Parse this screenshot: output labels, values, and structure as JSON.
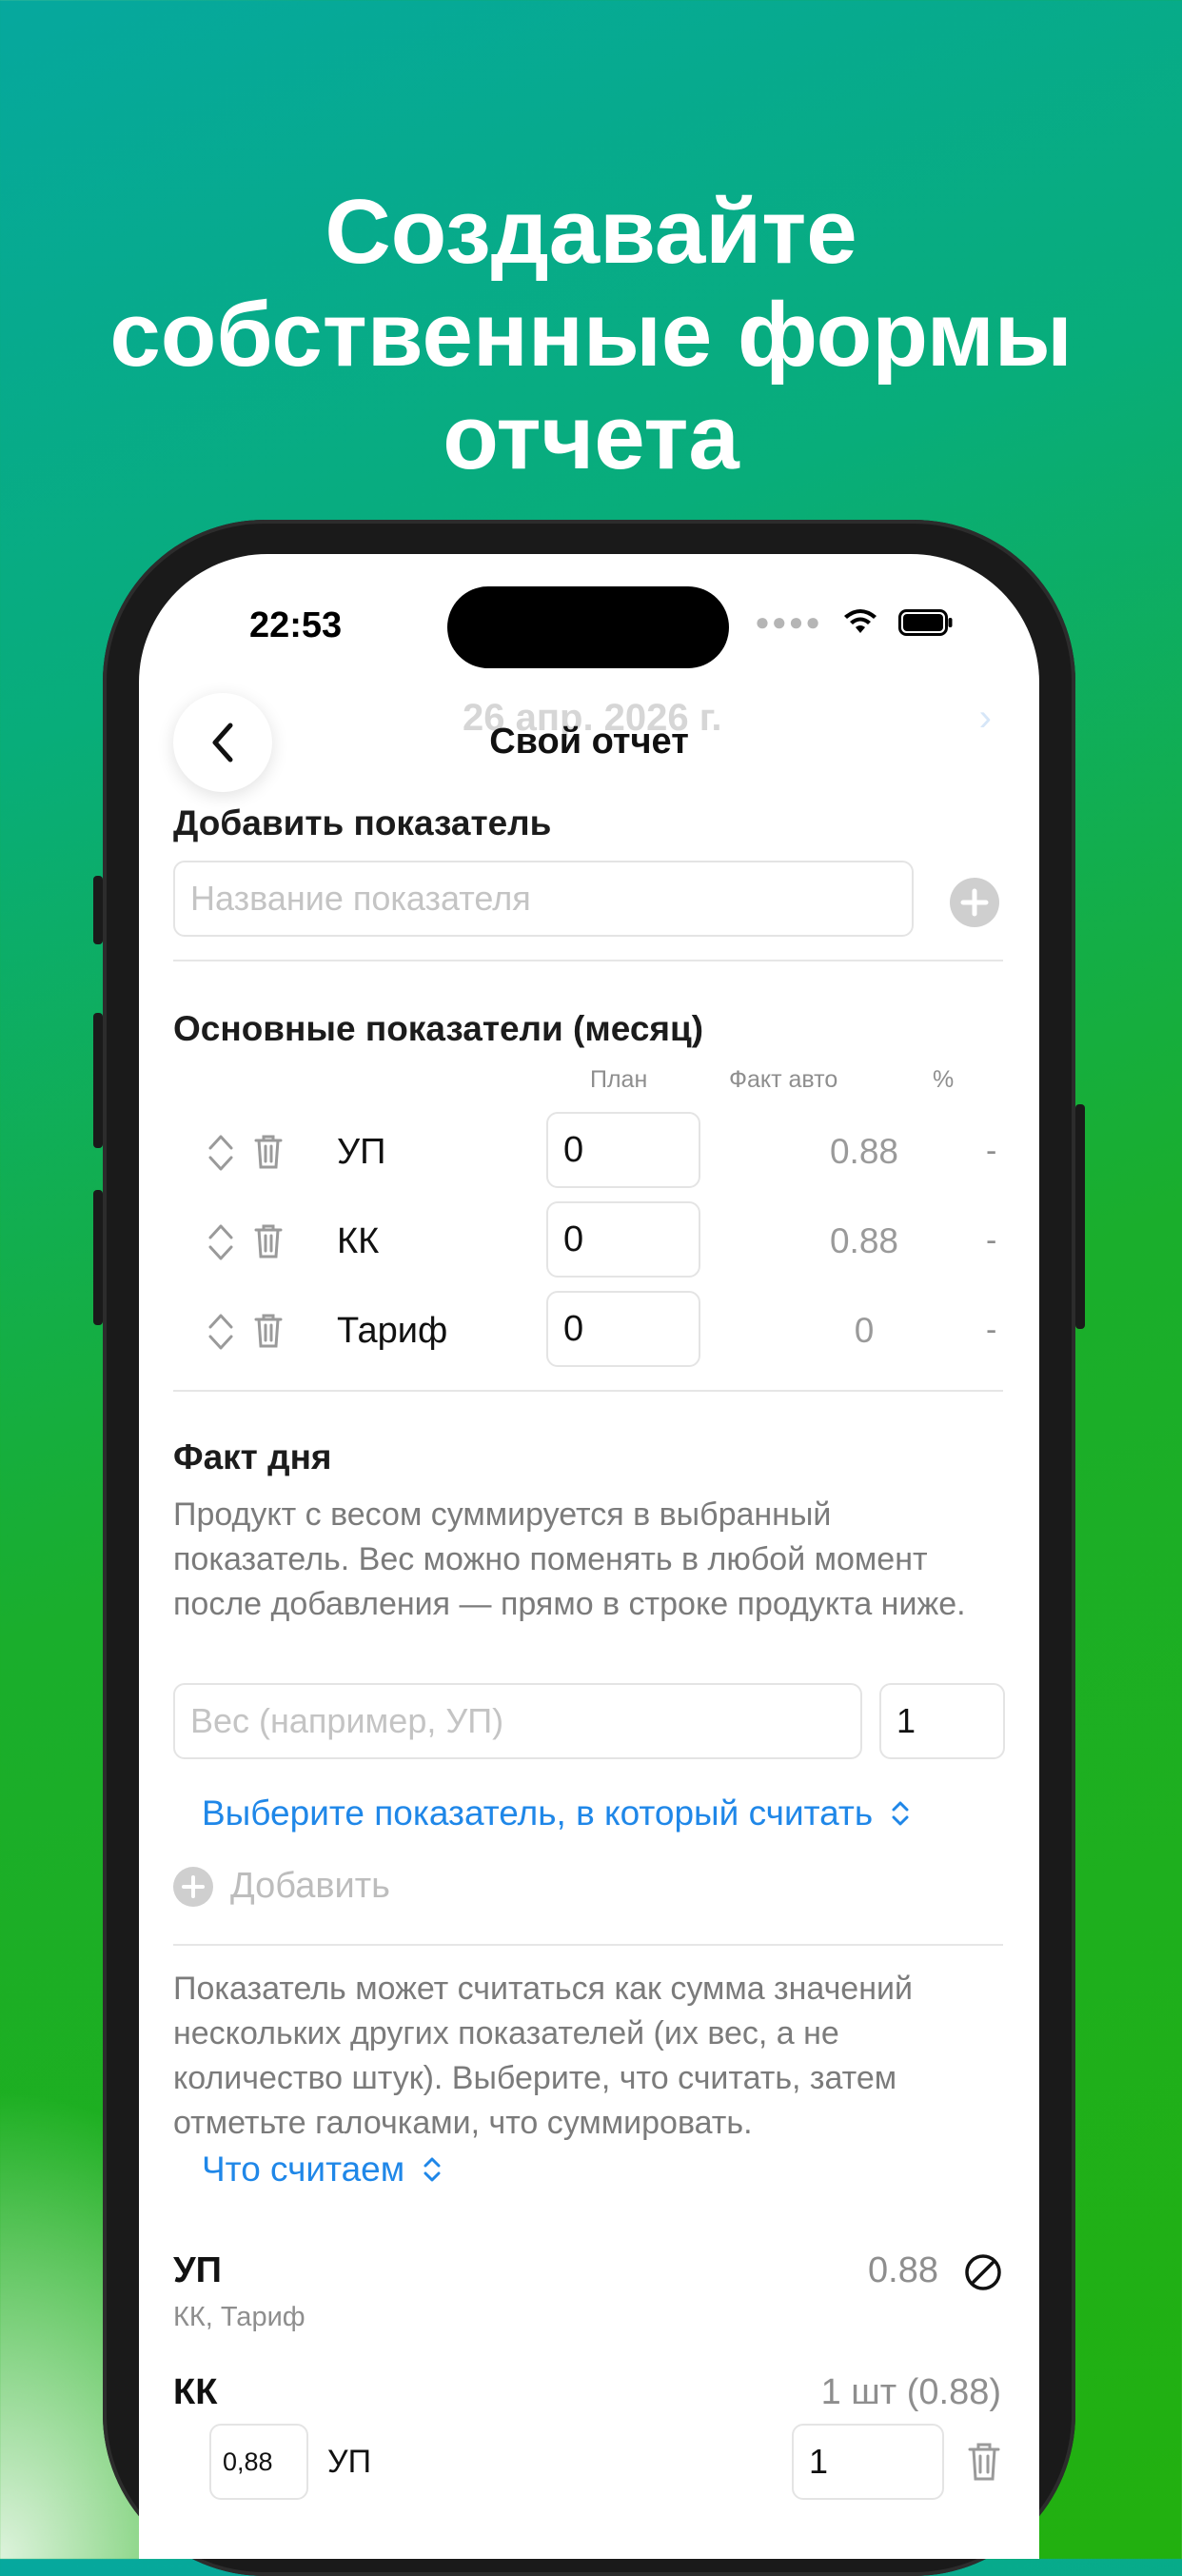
{
  "headline": [
    "Создавайте",
    "собственные формы",
    "отчета"
  ],
  "status": {
    "time": "22:53"
  },
  "nav": {
    "title": "Свой отчет",
    "ghost_date": "26 апр. 2026 г."
  },
  "add_metric": {
    "title": "Добавить показатель",
    "placeholder": "Название показателя"
  },
  "main_metrics": {
    "title": "Основные показатели (месяц)",
    "columns": {
      "plan": "План",
      "fact": "Факт авто",
      "pct": "%"
    },
    "rows": [
      {
        "name": "УП",
        "plan": "0",
        "fact": "0.88",
        "pct": "-"
      },
      {
        "name": "КК",
        "plan": "0",
        "fact": "0.88",
        "pct": "-"
      },
      {
        "name": "Тариф",
        "plan": "0",
        "fact": "0",
        "pct": "-"
      }
    ]
  },
  "day_fact": {
    "title": "Факт дня",
    "description": "Продукт с весом суммируется в выбранный показатель. Вес можно поменять в любой момент после добавления — прямо в строке продукта ниже.",
    "weight_placeholder": "Вес (например, УП)",
    "count_value": "1",
    "select_metric": "Выберите показатель, в который считать",
    "add_label": "Добавить",
    "sum_description": "Показатель может считаться как сумма значений нескольких других показателей (их вес, а не количество штук). Выберите, что считать, затем отметьте галочками, что суммировать.",
    "what_count": "Что считаем"
  },
  "aggregates": [
    {
      "name": "УП",
      "sub": "КК, Тариф",
      "value": "0.88"
    },
    {
      "name": "КК",
      "value": "1 шт (0.88)",
      "item": {
        "weight": "0,88",
        "target": "УП",
        "count": "1"
      }
    }
  ],
  "colors": {
    "accent": "#1f87e8",
    "bg_top": "#06a89e",
    "bg_bottom": "#22b00f"
  }
}
